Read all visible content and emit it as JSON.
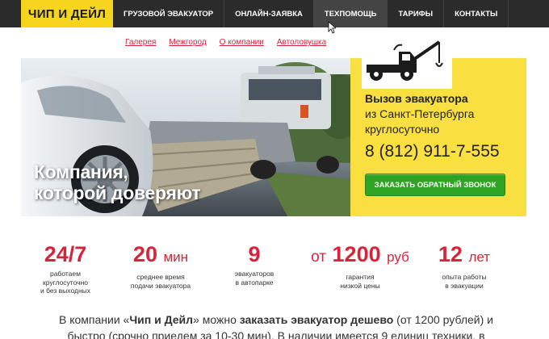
{
  "header": {
    "logo_text": "ЧИП И ДЕЙЛ",
    "nav": [
      {
        "label": "ГРУЗОВОЙ ЭВАКУАТОР"
      },
      {
        "label": "ОНЛАЙН-ЗАЯВКА"
      },
      {
        "label": "ТЕХПОМОЩЬ"
      },
      {
        "label": "ТАРИФЫ"
      },
      {
        "label": "КОНТАКТЫ"
      }
    ]
  },
  "sublinks": [
    "Галерея",
    "Межгород",
    "О компании",
    "Автоловушка"
  ],
  "hero": {
    "slogan_line1": "Компания,",
    "slogan_line2": "которой доверяют"
  },
  "call_box": {
    "title": "Вызов эвакуатора",
    "subtitle": "из Санкт-Петербурга круглосуточно",
    "phone": "8 (812) 911-7-555",
    "button": "ЗАКАЗАТЬ ОБРАТНЫЙ ЗВОНОК"
  },
  "stats": [
    {
      "prefix": "",
      "value": "24/7",
      "unit": "",
      "label_line1": "работаем",
      "label_line2": "круглосуточно",
      "label_line3": "и без выходных"
    },
    {
      "prefix": "",
      "value": "20",
      "unit": "мин",
      "label_line1": "среднее время",
      "label_line2": "подачи эвакуатора",
      "label_line3": ""
    },
    {
      "prefix": "",
      "value": "9",
      "unit": "",
      "label_line1": "эвакуаторов",
      "label_line2": "в автопарке",
      "label_line3": ""
    },
    {
      "prefix": "от",
      "value": "1200",
      "unit": "руб",
      "label_line1": "гарантия",
      "label_line2": "низкой цены",
      "label_line3": ""
    },
    {
      "prefix": "",
      "value": "12",
      "unit": "лет",
      "label_line1": "опыта работы",
      "label_line2": "в эвакуации",
      "label_line3": ""
    }
  ],
  "intro": {
    "t1": "В компании «",
    "brand": "Чип и Дейл",
    "t2": "» можно ",
    "bold": "заказать эвакуатор дешево",
    "t3": " (от 1200 рублей) и быстро (срочно приедем за 10-30 мин). В наличии имеется 9 единиц техники, в"
  }
}
